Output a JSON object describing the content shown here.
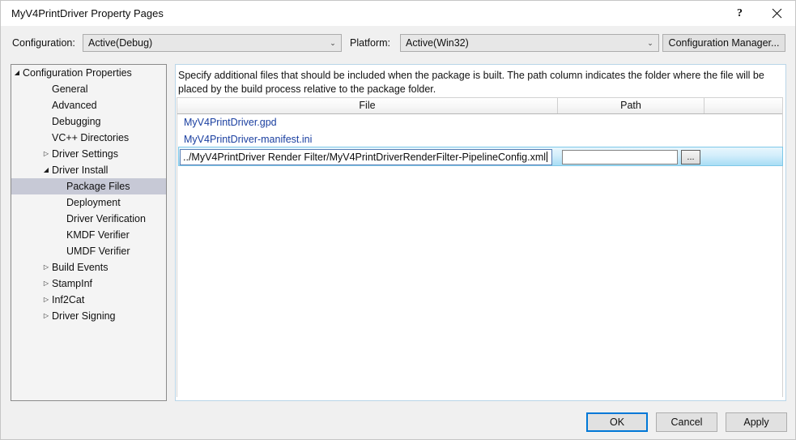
{
  "window": {
    "title": "MyV4PrintDriver Property Pages",
    "help_glyph": "?",
    "close_glyph": "✕"
  },
  "config_bar": {
    "configuration_label": "Configuration:",
    "configuration_value": "Active(Debug)",
    "platform_label": "Platform:",
    "platform_value": "Active(Win32)",
    "configuration_manager_label": "Configuration Manager...",
    "dropdown_arrow": "⌄"
  },
  "tree": {
    "items": [
      {
        "label": "Configuration Properties",
        "indent": 14,
        "expander": "expanded",
        "selected": false
      },
      {
        "label": "General",
        "indent": 50,
        "expander": "none",
        "selected": false
      },
      {
        "label": "Advanced",
        "indent": 50,
        "expander": "none",
        "selected": false
      },
      {
        "label": "Debugging",
        "indent": 50,
        "expander": "none",
        "selected": false
      },
      {
        "label": "VC++ Directories",
        "indent": 50,
        "expander": "none",
        "selected": false
      },
      {
        "label": "Driver Settings",
        "indent": 50,
        "expander": "collapsed",
        "selected": false
      },
      {
        "label": "Driver Install",
        "indent": 50,
        "expander": "expanded",
        "selected": false
      },
      {
        "label": "Package Files",
        "indent": 68,
        "expander": "none",
        "selected": true
      },
      {
        "label": "Deployment",
        "indent": 68,
        "expander": "none",
        "selected": false
      },
      {
        "label": "Driver Verification",
        "indent": 68,
        "expander": "none",
        "selected": false
      },
      {
        "label": "KMDF Verifier",
        "indent": 68,
        "expander": "none",
        "selected": false
      },
      {
        "label": "UMDF Verifier",
        "indent": 68,
        "expander": "none",
        "selected": false
      },
      {
        "label": "Build Events",
        "indent": 50,
        "expander": "collapsed",
        "selected": false
      },
      {
        "label": "StampInf",
        "indent": 50,
        "expander": "collapsed",
        "selected": false
      },
      {
        "label": "Inf2Cat",
        "indent": 50,
        "expander": "collapsed",
        "selected": false
      },
      {
        "label": "Driver Signing",
        "indent": 50,
        "expander": "collapsed",
        "selected": false
      }
    ],
    "expander_expanded_glyph": "◢",
    "expander_collapsed_glyph": "▷"
  },
  "main": {
    "description": "Specify additional files that should be included when the package is built.  The path column indicates the folder where the file will be placed by the build process relative to the package folder.",
    "grid": {
      "columns": [
        "File",
        "Path",
        ""
      ],
      "rows": [
        {
          "file": "MyV4PrintDriver.gpd",
          "path": ""
        },
        {
          "file": "MyV4PrintDriver-manifest.ini",
          "path": ""
        }
      ],
      "edit_row": {
        "file_value": "../MyV4PrintDriver Render Filter/MyV4PrintDriverRenderFilter-PipelineConfig.xml",
        "path_value": "",
        "browse_label": "..."
      }
    }
  },
  "footer": {
    "ok_label": "OK",
    "cancel_label": "Cancel",
    "apply_label": "Apply"
  }
}
